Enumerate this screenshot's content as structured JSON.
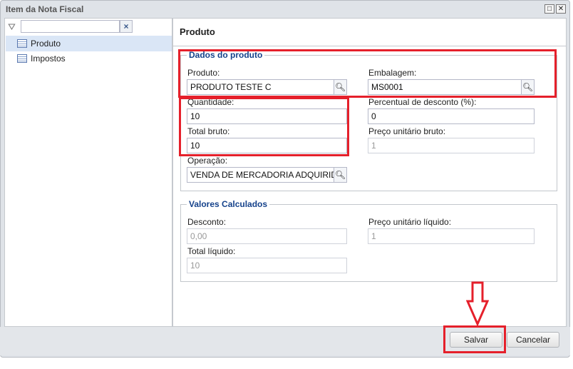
{
  "window": {
    "title": "Item da Nota Fiscal"
  },
  "sidebar": {
    "filter_value": "",
    "items": [
      {
        "label": "Produto",
        "selected": true
      },
      {
        "label": "Impostos",
        "selected": false
      }
    ]
  },
  "panel": {
    "title": "Produto"
  },
  "dados": {
    "legend": "Dados do produto",
    "produto": {
      "label": "Produto:",
      "value": "PRODUTO TESTE C"
    },
    "embalagem": {
      "label": "Embalagem:",
      "value": "MS0001"
    },
    "quantidade": {
      "label": "Quantidade:",
      "value": "10"
    },
    "percentual": {
      "label": "Percentual de desconto (%):",
      "value": "0"
    },
    "total_bruto": {
      "label": "Total bruto:",
      "value": "10"
    },
    "preco_bruto": {
      "label": "Preço unitário bruto:",
      "value": "1"
    },
    "operacao": {
      "label": "Operação:",
      "value": "VENDA DE MERCADORIA ADQUIRIDA"
    }
  },
  "calculados": {
    "legend": "Valores Calculados",
    "desconto": {
      "label": "Desconto:",
      "value": "0,00"
    },
    "preco_liquido": {
      "label": "Preço unitário líquido:",
      "value": "1"
    },
    "total_liquido": {
      "label": "Total líquido:",
      "value": "10"
    }
  },
  "footer": {
    "save": "Salvar",
    "cancel": "Cancelar"
  },
  "annotation_color": "#e5202b"
}
